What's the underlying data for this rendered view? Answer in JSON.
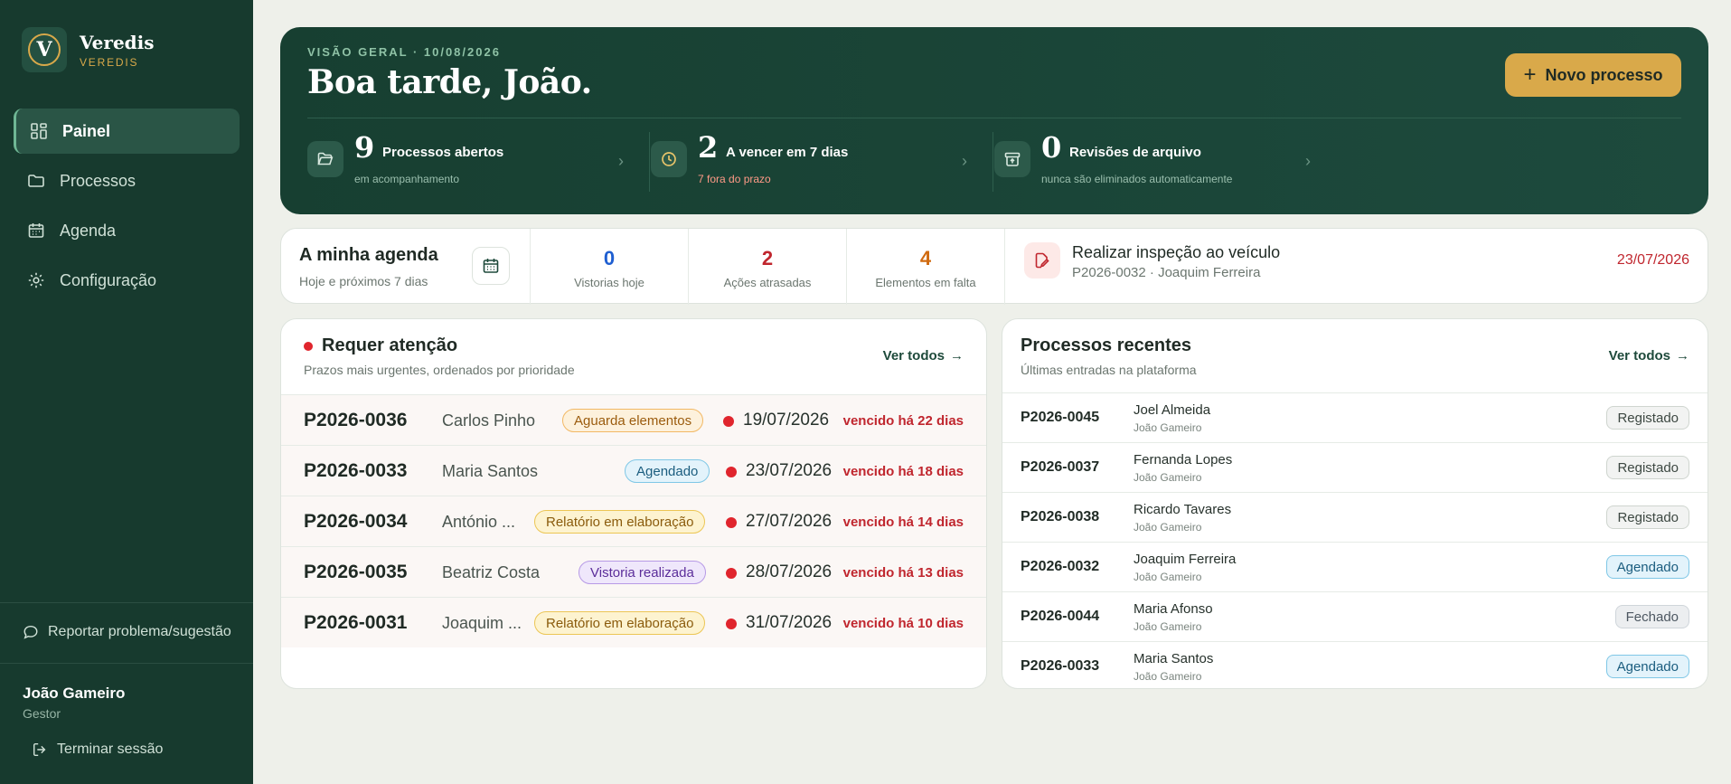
{
  "brand": {
    "name": "Veredis",
    "subtitle": "VEREDIS",
    "logo_letter": "V"
  },
  "nav": [
    {
      "label": "Painel",
      "icon": "grid-icon",
      "active": true
    },
    {
      "label": "Processos",
      "icon": "folder-icon",
      "active": false
    },
    {
      "label": "Agenda",
      "icon": "calendar-icon",
      "active": false
    },
    {
      "label": "Configuração",
      "icon": "gear-icon",
      "active": false
    }
  ],
  "sidebar_footer": {
    "report_label": "Reportar problema/sugestão",
    "user_name": "João Gameiro",
    "user_role": "Gestor",
    "logout_label": "Terminar sessão"
  },
  "hero": {
    "kicker": "VISÃO GERAL · 10/08/2026",
    "greeting": "Boa tarde, João.",
    "new_button": "Novo processo",
    "stats": [
      {
        "number": "9",
        "label": "Processos abertos",
        "sub": "em acompanhamento",
        "icon": "folder-open-icon"
      },
      {
        "number": "2",
        "label": "A vencer em 7 dias",
        "sub": "7 fora do prazo",
        "icon": "clock-icon"
      },
      {
        "number": "0",
        "label": "Revisões de arquivo",
        "sub": "nunca são eliminados automaticamente",
        "icon": "archive-icon"
      }
    ]
  },
  "agenda": {
    "title": "A minha agenda",
    "subtitle": "Hoje e próximos 7 dias",
    "metrics": [
      {
        "value": "0",
        "label": "Vistorias hoje",
        "color": "#1f5fd1"
      },
      {
        "value": "2",
        "label": "Ações atrasadas",
        "color": "#c0262e"
      },
      {
        "value": "4",
        "label": "Elementos em falta",
        "color": "#d06a10"
      }
    ],
    "task": {
      "title": "Realizar inspeção ao veículo",
      "sub": "P2026-0032 · Joaquim Ferreira",
      "date": "23/07/2026"
    }
  },
  "attention": {
    "title": "Requer atenção",
    "subtitle": "Prazos mais urgentes, ordenados por prioridade",
    "see_all": "Ver todos",
    "rows": [
      {
        "id": "P2026-0036",
        "name": "Carlos Pinho",
        "status": "Aguarda elementos",
        "date": "19/07/2026",
        "overdue": "vencido há 22 dias"
      },
      {
        "id": "P2026-0033",
        "name": "Maria Santos",
        "status": "Agendado",
        "date": "23/07/2026",
        "overdue": "vencido há 18 dias"
      },
      {
        "id": "P2026-0034",
        "name": "António ...",
        "status": "Relatório em elaboração",
        "date": "27/07/2026",
        "overdue": "vencido há 14 dias"
      },
      {
        "id": "P2026-0035",
        "name": "Beatriz Costa",
        "status": "Vistoria realizada",
        "date": "28/07/2026",
        "overdue": "vencido há 13 dias"
      },
      {
        "id": "P2026-0031",
        "name": "Joaquim ...",
        "status": "Relatório em elaboração",
        "date": "31/07/2026",
        "overdue": "vencido há 10 dias"
      }
    ]
  },
  "recent": {
    "title": "Processos recentes",
    "subtitle": "Últimas entradas na plataforma",
    "see_all": "Ver todos",
    "rows": [
      {
        "id": "P2026-0045",
        "name": "Joel Almeida",
        "owner": "João Gameiro",
        "status": "Registado"
      },
      {
        "id": "P2026-0037",
        "name": "Fernanda Lopes",
        "owner": "João Gameiro",
        "status": "Registado"
      },
      {
        "id": "P2026-0038",
        "name": "Ricardo Tavares",
        "owner": "João Gameiro",
        "status": "Registado"
      },
      {
        "id": "P2026-0032",
        "name": "Joaquim Ferreira",
        "owner": "João Gameiro",
        "status": "Agendado"
      },
      {
        "id": "P2026-0044",
        "name": "Maria Afonso",
        "owner": "João Gameiro",
        "status": "Fechado"
      },
      {
        "id": "P2026-0033",
        "name": "Maria Santos",
        "owner": "João Gameiro",
        "status": "Agendado"
      }
    ]
  }
}
